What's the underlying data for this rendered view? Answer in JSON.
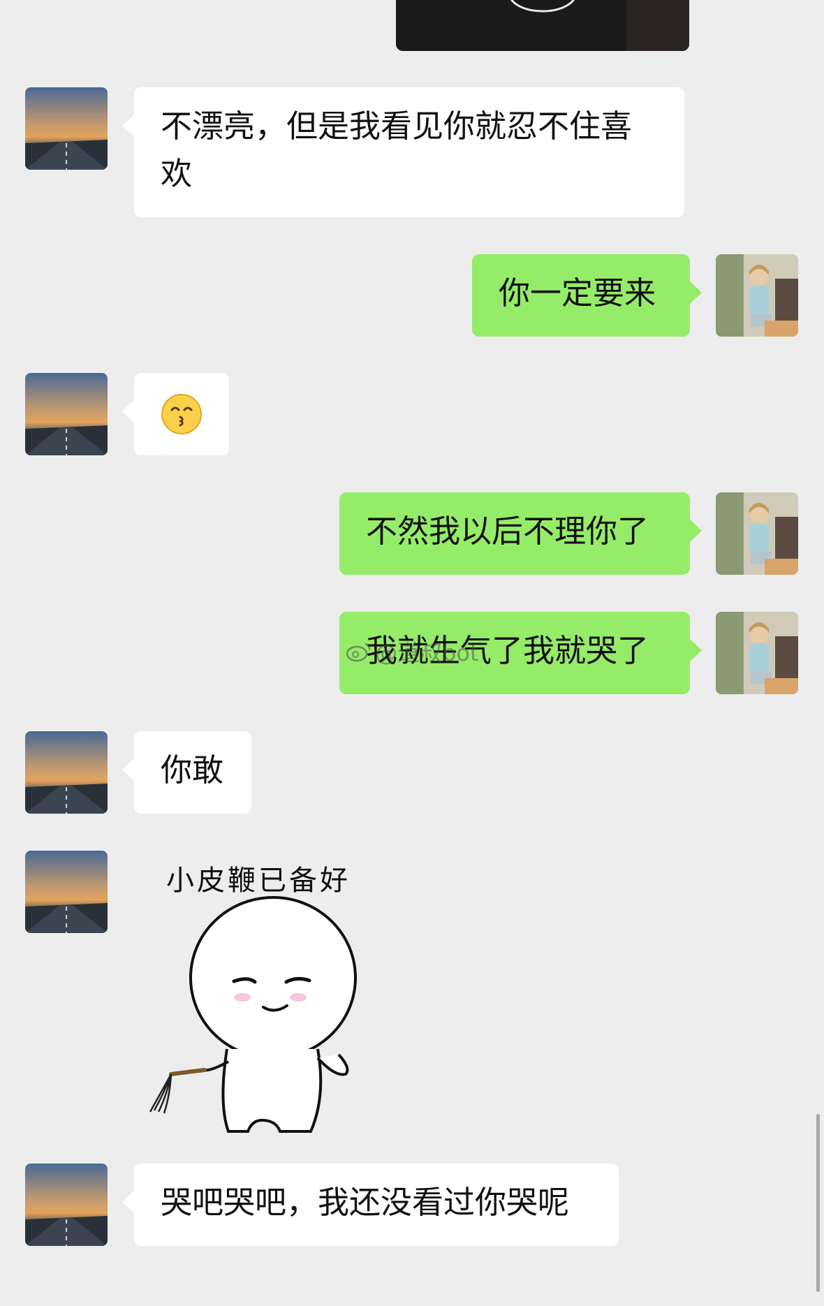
{
  "chat": {
    "watermark": "@道叔bot",
    "messages": [
      {
        "id": "m1",
        "text": "不漂亮，但是我看见你就忍不住喜欢"
      },
      {
        "id": "m2",
        "text": "你一定要来"
      },
      {
        "id": "m3",
        "emoji": "😚"
      },
      {
        "id": "m4",
        "text": "不然我以后不理你了"
      },
      {
        "id": "m5",
        "text": "我就生气了我就哭了"
      },
      {
        "id": "m6",
        "text": "你敢"
      },
      {
        "id": "m7",
        "sticker_caption": "小皮鞭已备好"
      },
      {
        "id": "m8",
        "text": "哭吧哭吧，我还没看过你哭呢"
      }
    ]
  },
  "colors": {
    "background": "#ededed",
    "incoming_bubble": "#ffffff",
    "outgoing_bubble": "#95ec69"
  },
  "icons": {
    "weibo": "weibo-icon"
  }
}
